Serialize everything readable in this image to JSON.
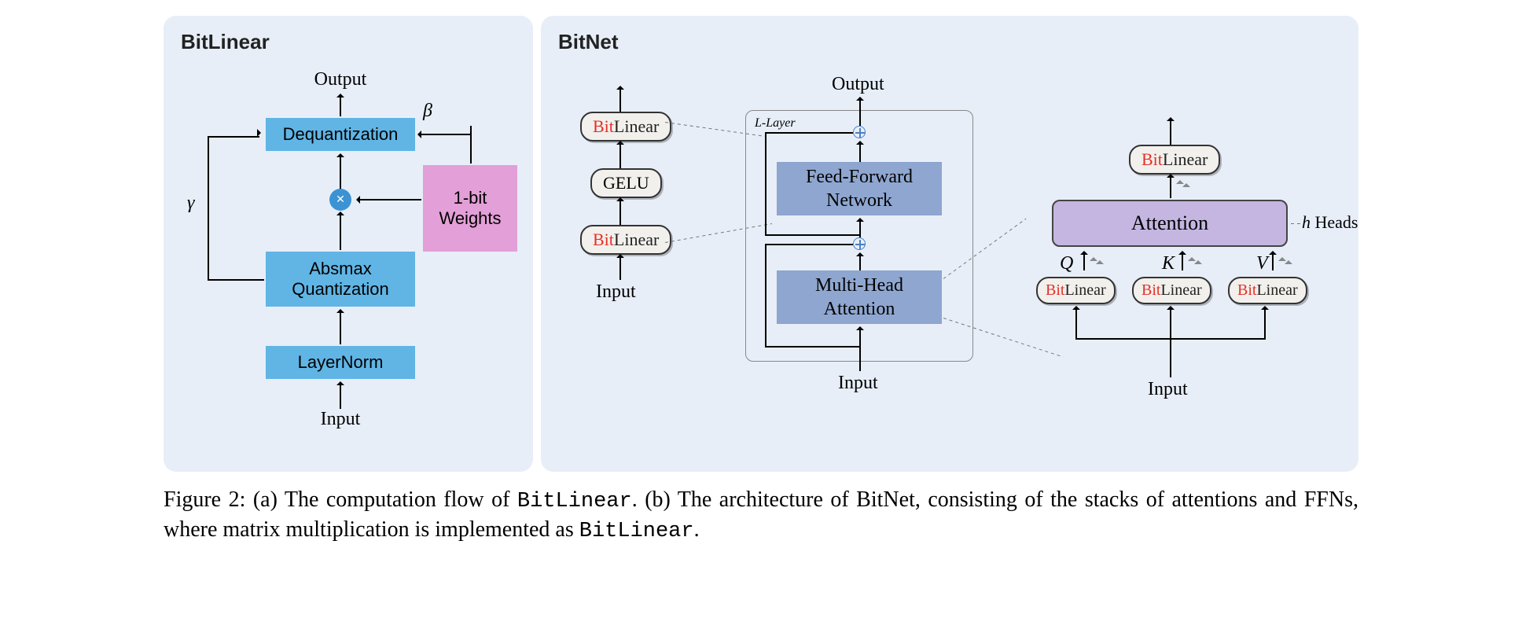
{
  "panelA": {
    "title": "BitLinear",
    "output": "Output",
    "dequant": "Dequantization",
    "absmax": "Absmax\nQuantization",
    "layernorm": "LayerNorm",
    "weights": "1-bit\nWeights",
    "input": "Input",
    "gamma": "γ",
    "beta": "β"
  },
  "panelB": {
    "title": "BitNet",
    "ffn_stack": {
      "top": "BitLinear",
      "mid": "GELU",
      "bottom": "BitLinear",
      "input": "Input"
    },
    "layer": {
      "tag": "L-Layer",
      "output": "Output",
      "ffn": "Feed-Forward\nNetwork",
      "mha": "Multi-Head\nAttention",
      "input": "Input"
    },
    "attn": {
      "top": "BitLinear",
      "block": "Attention",
      "heads": "h Heads",
      "q": "Q",
      "k": "K",
      "v": "V",
      "qpill": "BitLinear",
      "kpill": "BitLinear",
      "vpill": "BitLinear",
      "input": "Input"
    }
  },
  "caption": {
    "prefix": "Figure 2: (a) The computation flow of ",
    "code1": "BitLinear",
    "mid": ". (b) The architecture of BitNet, consisting of the stacks of attentions and FFNs, where matrix multiplication is implemented as ",
    "code2": "BitLinear",
    "suffix": "."
  }
}
